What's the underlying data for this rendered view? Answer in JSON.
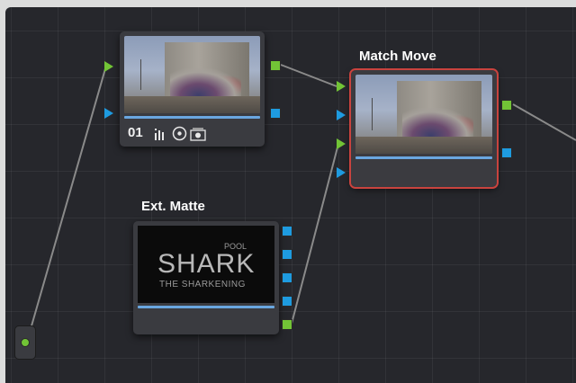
{
  "nodes": {
    "clip": {
      "number": "01",
      "icons": [
        "bars-icon",
        "circle-dot-icon",
        "camera-icon"
      ]
    },
    "match_move": {
      "title": "Match Move"
    },
    "ext_matte": {
      "title": "Ext. Matte",
      "thumb_small": "POOL",
      "thumb_big": "SHARK",
      "thumb_sub": "THE SHARKENING"
    }
  },
  "colors": {
    "rgb_port": "#72c436",
    "alpha_port": "#1e9be0",
    "selected_outline": "#c9433e"
  }
}
